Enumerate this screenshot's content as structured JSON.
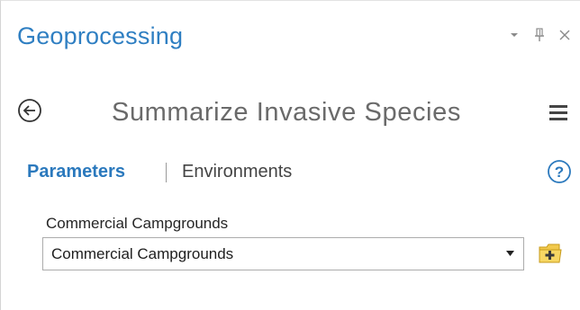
{
  "pane": {
    "title": "Geoprocessing",
    "controls": {
      "options_icon": "chevron-down-icon",
      "pin_icon": "pin-icon",
      "close_icon": "close-icon"
    }
  },
  "tool": {
    "name": "Summarize Invasive Species",
    "back_icon": "back-arrow-icon",
    "menu_icon": "hamburger-menu-icon"
  },
  "tabs": {
    "parameters_label": "Parameters",
    "environments_label": "Environments",
    "help_icon": "help-icon"
  },
  "parameters": [
    {
      "label": "Commercial Campgrounds",
      "value": "Commercial Campgrounds",
      "browse_icon": "add-folder-icon"
    }
  ],
  "colors": {
    "accent": "#2f7fc2",
    "tab_active": "#2b79bd",
    "tool_name": "#6a6a6a",
    "folder": "#f2c94c"
  }
}
